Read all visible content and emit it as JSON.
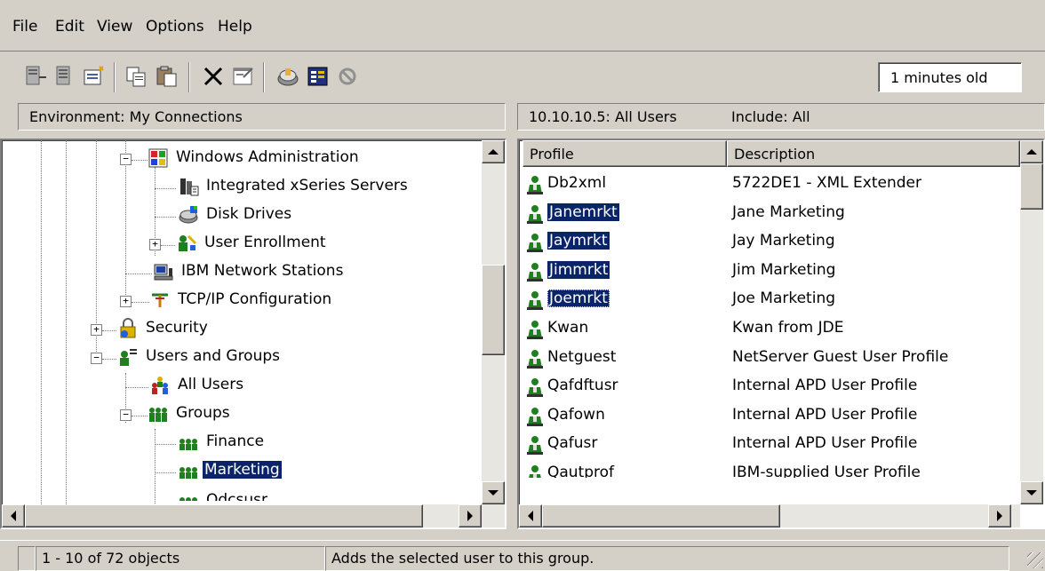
{
  "menu": {
    "file": "File",
    "edit": "Edit",
    "view": "View",
    "options": "Options",
    "help": "Help"
  },
  "toolbar": {
    "age": "1 minutes old",
    "buttons": [
      "connect-icon",
      "disconnect-icon",
      "new-icon",
      "copy-icon",
      "paste-icon",
      "delete-icon",
      "properties-icon",
      "monitor-icon",
      "views-icon",
      "stop-icon"
    ]
  },
  "left_header": "Environment: My Connections",
  "right_header": {
    "system": "10.10.10.5:  All Users",
    "include": "Include: All"
  },
  "tree": {
    "windows_admin": "Windows Administration",
    "xseries": "Integrated xSeries Servers",
    "disk_drives": "Disk Drives",
    "user_enrollment": "User Enrollment",
    "network_stations": "IBM Network Stations",
    "tcpip": "TCP/IP Configuration",
    "security": "Security",
    "users_groups": "Users and Groups",
    "all_users": "All Users",
    "groups": "Groups",
    "finance": "Finance",
    "marketing": "Marketing",
    "odcsusr": "Odcsusr"
  },
  "list": {
    "col_profile": "Profile",
    "col_description": "Description",
    "rows": [
      {
        "profile": "Db2xml",
        "description": "5722DE1 - XML Extender",
        "selected": false
      },
      {
        "profile": "Janemrkt",
        "description": "Jane Marketing",
        "selected": true
      },
      {
        "profile": "Jaymrkt",
        "description": "Jay Marketing",
        "selected": true
      },
      {
        "profile": "Jimmrkt",
        "description": "Jim Marketing",
        "selected": true
      },
      {
        "profile": "Joemrkt",
        "description": "Joe Marketing",
        "selected": true
      },
      {
        "profile": "Kwan",
        "description": "Kwan from JDE",
        "selected": false
      },
      {
        "profile": "Netguest",
        "description": "NetServer Guest User Profile",
        "selected": false
      },
      {
        "profile": "Qafdftusr",
        "description": "Internal APD User Profile",
        "selected": false
      },
      {
        "profile": "Qafown",
        "description": "Internal APD User Profile",
        "selected": false
      },
      {
        "profile": "Qafusr",
        "description": "Internal APD User Profile",
        "selected": false
      },
      {
        "profile": "Qautprof",
        "description": "IBM-supplied User Profile",
        "selected": false
      }
    ]
  },
  "status": {
    "count": "1 - 10 of 72 objects",
    "message": "Adds the selected user to this group."
  },
  "colors": {
    "selection": "#0a246a",
    "face": "#d4d0c8"
  }
}
